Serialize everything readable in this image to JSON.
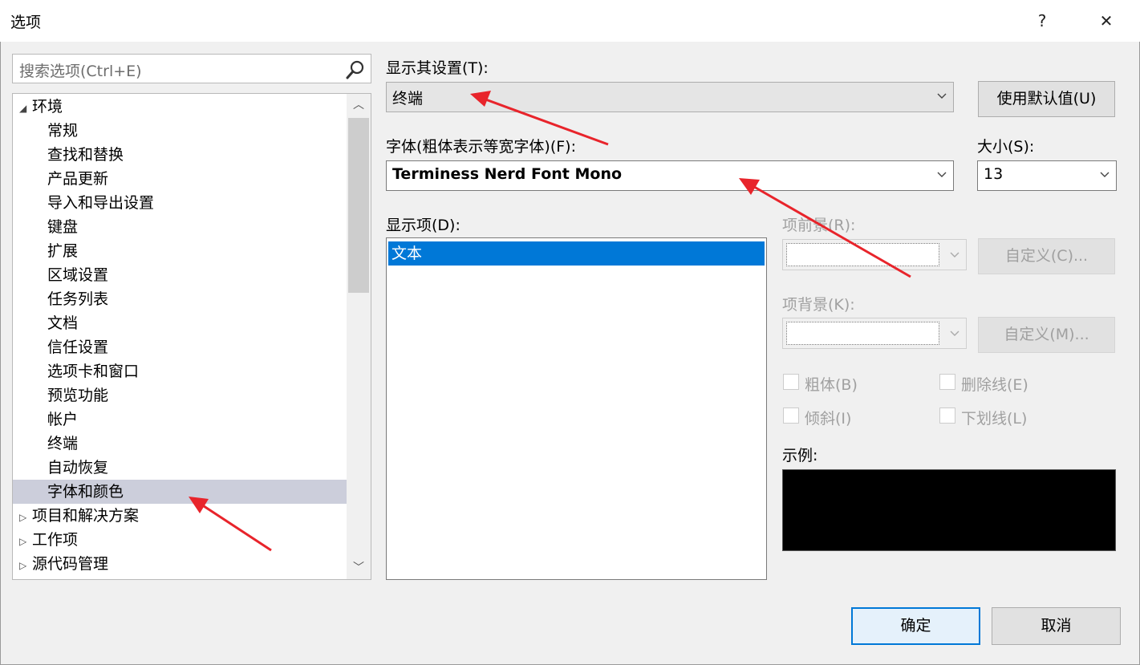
{
  "window": {
    "title": "选项",
    "help_glyph": "?",
    "close_glyph": "✕"
  },
  "search": {
    "placeholder": "搜索选项(Ctrl+E)"
  },
  "tree": {
    "items": [
      {
        "label": "环境",
        "kind": "parent",
        "expanded": true
      },
      {
        "label": "常规",
        "kind": "child"
      },
      {
        "label": "查找和替换",
        "kind": "child"
      },
      {
        "label": "产品更新",
        "kind": "child"
      },
      {
        "label": "导入和导出设置",
        "kind": "child"
      },
      {
        "label": "键盘",
        "kind": "child"
      },
      {
        "label": "扩展",
        "kind": "child"
      },
      {
        "label": "区域设置",
        "kind": "child"
      },
      {
        "label": "任务列表",
        "kind": "child"
      },
      {
        "label": "文档",
        "kind": "child"
      },
      {
        "label": "信任设置",
        "kind": "child"
      },
      {
        "label": "选项卡和窗口",
        "kind": "child"
      },
      {
        "label": "预览功能",
        "kind": "child"
      },
      {
        "label": "帐户",
        "kind": "child"
      },
      {
        "label": "终端",
        "kind": "child"
      },
      {
        "label": "自动恢复",
        "kind": "child"
      },
      {
        "label": "字体和颜色",
        "kind": "child",
        "selected": true
      },
      {
        "label": "项目和解决方案",
        "kind": "parent",
        "expanded": false
      },
      {
        "label": "工作项",
        "kind": "parent",
        "expanded": false
      },
      {
        "label": "源代码管理",
        "kind": "parent",
        "expanded": false
      }
    ],
    "expanded_glyph": "◢",
    "collapsed_glyph": "▷"
  },
  "settings": {
    "show_label": "显示其设置(T):",
    "show_value": "终端",
    "use_defaults": "使用默认值(U)",
    "font_label": "字体(粗体表示等宽字体)(F):",
    "font_value": "Terminess Nerd Font Mono",
    "size_label": "大小(S):",
    "size_value": "13",
    "display_items_label": "显示项(D):",
    "display_items": [
      "文本"
    ],
    "fg_label": "项前景(R):",
    "fg_custom": "自定义(C)...",
    "bg_label": "项背景(K):",
    "bg_custom": "自定义(M)...",
    "bold_label": "粗体(B)",
    "strike_label": "删除线(E)",
    "italic_label": "倾斜(I)",
    "underline_label": "下划线(L)",
    "sample_label": "示例:"
  },
  "footer": {
    "ok": "确定",
    "cancel": "取消"
  },
  "colors": {
    "selection": "#0078d7",
    "tree_selection": "#cccedb",
    "annotation_arrow": "#e8242b",
    "preview_bg": "#000000"
  }
}
